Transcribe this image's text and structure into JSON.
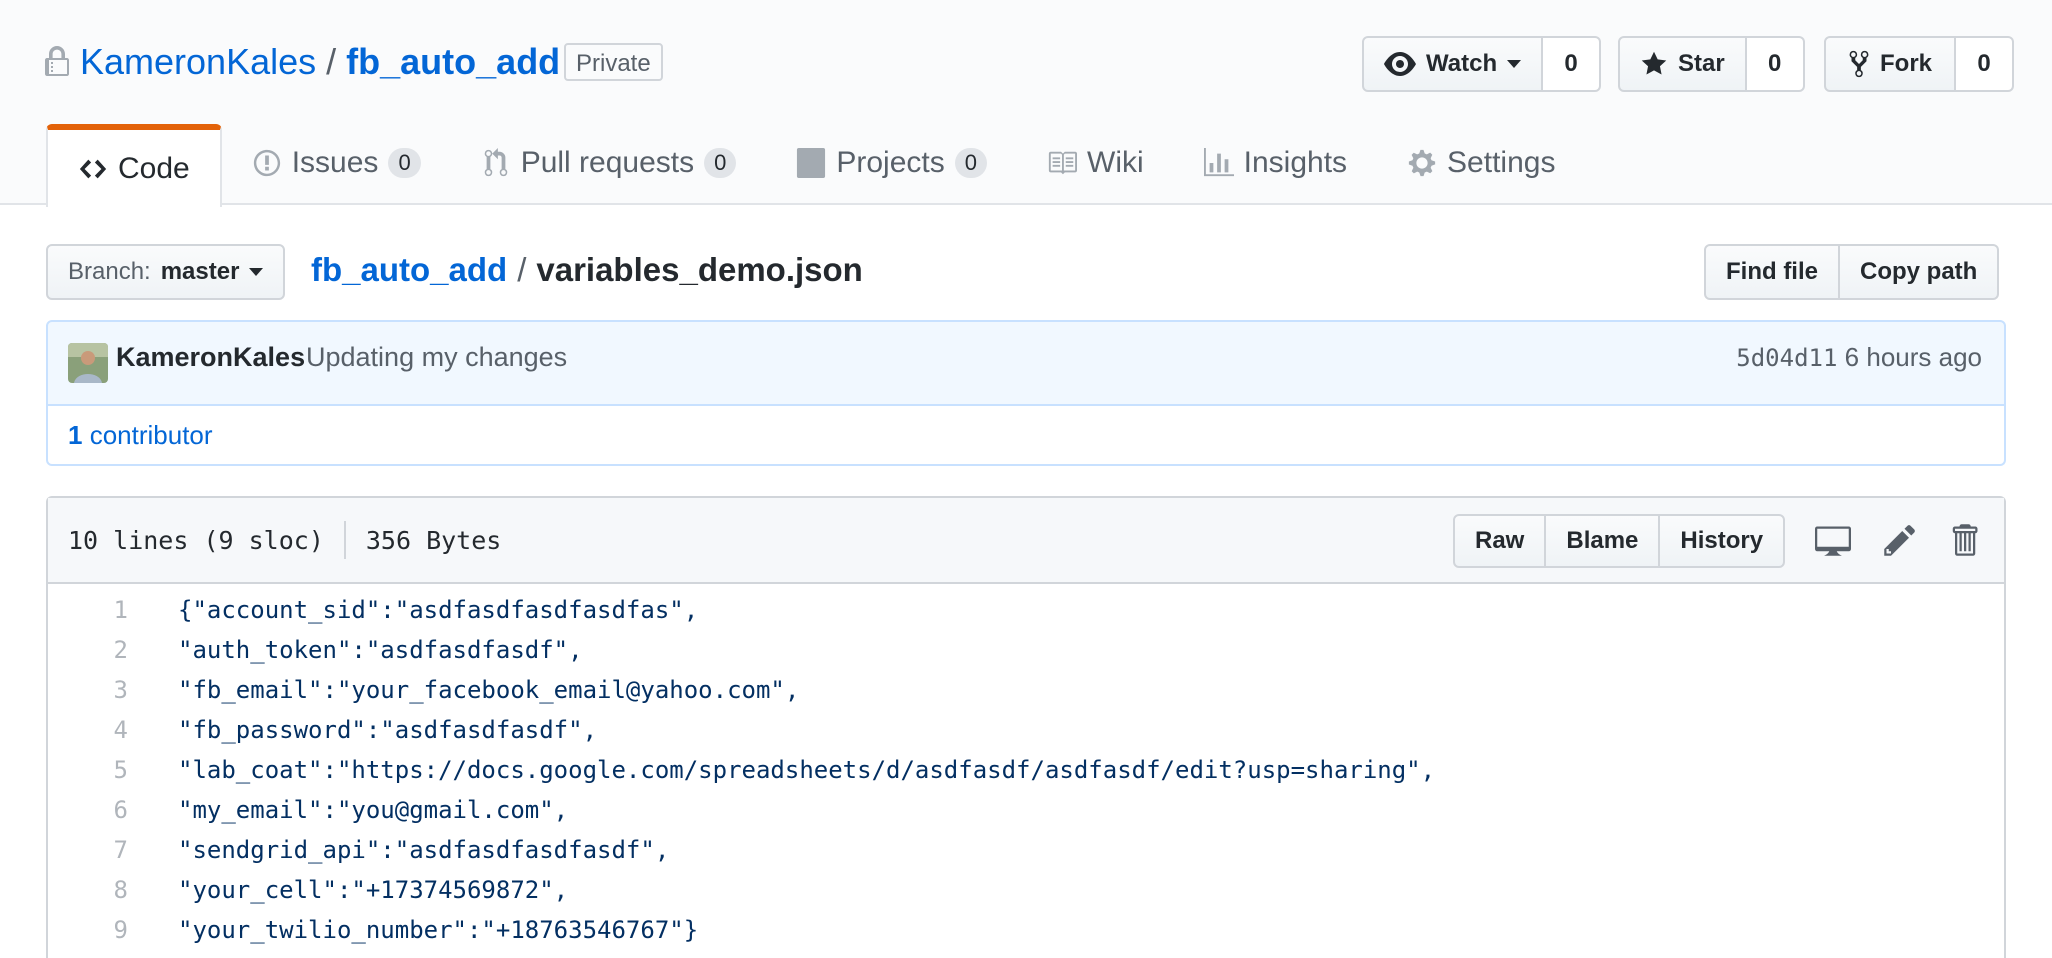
{
  "repo": {
    "owner": "KameronKales",
    "separator": "/",
    "name": "fb_auto_add",
    "visibility": "Private"
  },
  "actions": {
    "watch": {
      "label": "Watch",
      "count": "0"
    },
    "star": {
      "label": "Star",
      "count": "0"
    },
    "fork": {
      "label": "Fork",
      "count": "0"
    }
  },
  "tabs": [
    {
      "label": "Code",
      "icon": "code-icon",
      "selected": true
    },
    {
      "label": "Issues",
      "icon": "issue-opened-icon",
      "counter": "0"
    },
    {
      "label": "Pull requests",
      "icon": "git-pull-request-icon",
      "counter": "0"
    },
    {
      "label": "Projects",
      "icon": "project-icon",
      "counter": "0"
    },
    {
      "label": "Wiki",
      "icon": "book-icon"
    },
    {
      "label": "Insights",
      "icon": "graph-icon"
    },
    {
      "label": "Settings",
      "icon": "gear-icon"
    }
  ],
  "file_nav": {
    "branch_prefix": "Branch:",
    "branch_name": "master",
    "breadcrumb_root": "fb_auto_add",
    "breadcrumb_sep": "/",
    "file_name": "variables_demo.json",
    "find_file": "Find file",
    "copy_path": "Copy path"
  },
  "commit": {
    "author": "KameronKales",
    "message": "Updating my changes",
    "sha": "5d04d11",
    "time": "6 hours ago",
    "contributors_count": "1",
    "contributors_label": "contributor"
  },
  "file": {
    "lines_info": "10 lines (9 sloc)",
    "size": "356 Bytes",
    "raw": "Raw",
    "blame": "Blame",
    "history": "History",
    "code_lines": [
      {
        "num": "1",
        "text": "{\"account_sid\":\"asdfasdfasdfasdfas\","
      },
      {
        "num": "2",
        "text": "\"auth_token\":\"asdfasdfasdf\","
      },
      {
        "num": "3",
        "text": "\"fb_email\":\"your_facebook_email@yahoo.com\","
      },
      {
        "num": "4",
        "text": "\"fb_password\":\"asdfasdfasdf\","
      },
      {
        "num": "5",
        "text": "\"lab_coat\":\"https://docs.google.com/spreadsheets/d/asdfasdf/asdfasdf/edit?usp=sharing\","
      },
      {
        "num": "6",
        "text": "\"my_email\":\"you@gmail.com\","
      },
      {
        "num": "7",
        "text": "\"sendgrid_api\":\"asdfasdfasdfasdf\","
      },
      {
        "num": "8",
        "text": "\"your_cell\":\"+17374569872\","
      },
      {
        "num": "9",
        "text": "\"your_twilio_number\":\"+18763546767\"}"
      }
    ]
  },
  "colors": {
    "link": "#0366d6",
    "tab_accent": "#e36209",
    "commit_bg": "#f1f8ff",
    "code_string": "#032f62"
  }
}
